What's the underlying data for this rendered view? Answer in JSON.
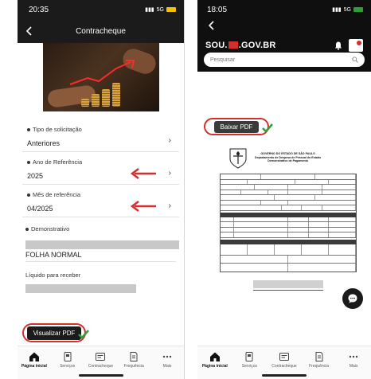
{
  "left": {
    "status": {
      "time": "20:35",
      "network": "5G"
    },
    "appbar": {
      "title": "Contracheque"
    },
    "fields": [
      {
        "label": "Tipo de solicitação",
        "value": "Anteriores"
      },
      {
        "label": "Ano de Referência",
        "value": "2025"
      },
      {
        "label": "Mês de referência",
        "value": "04/2025"
      }
    ],
    "demonstrativo": {
      "label": "Demonstrativo",
      "value": "FOLHA NORMAL"
    },
    "net": {
      "label": "Líquido para receber"
    },
    "pdf_button": "Visualizar PDF"
  },
  "right": {
    "status": {
      "time": "18:05",
      "network": "5G"
    },
    "brand": {
      "pre": "SOU.",
      "post": ".GOV.BR"
    },
    "search": {
      "placeholder": "Pesquisar"
    },
    "download_button": "Baixar PDF",
    "document": {
      "title_lines": [
        "GOVERNO DO ESTADO DE SÃO PAULO",
        "Departamento de Despesa de Pessoal do Estado",
        "Demonstrativo de Pagamento"
      ]
    }
  },
  "nav": {
    "items": [
      {
        "label": "Página inicial",
        "icon": "home-icon"
      },
      {
        "label": "Serviços",
        "icon": "services-icon"
      },
      {
        "label": "Contracheque",
        "icon": "paycheck-icon"
      },
      {
        "label": "Frequência",
        "icon": "attendance-icon"
      },
      {
        "label": "Mais",
        "icon": "more-icon"
      }
    ]
  },
  "colors": {
    "accent_red": "#d32f2f",
    "header_dark": "#1b1b1b",
    "check_green": "#2e9d3a"
  }
}
